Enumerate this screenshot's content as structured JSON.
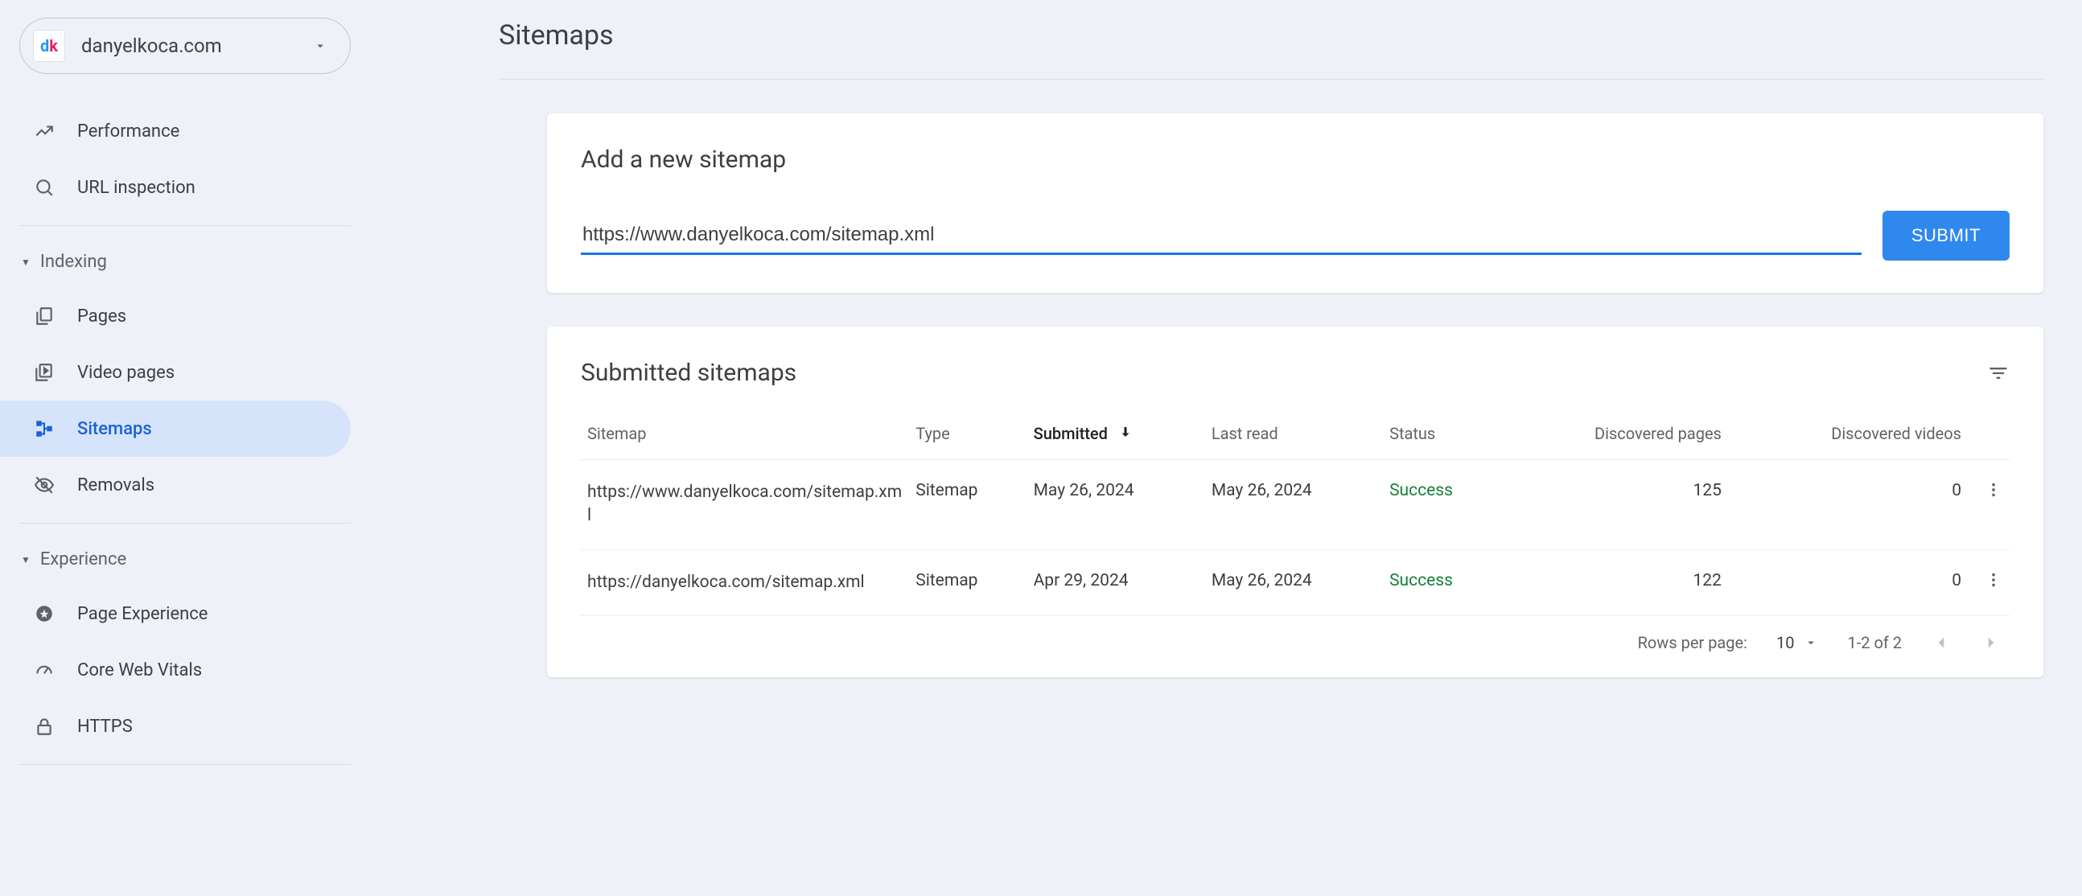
{
  "property": {
    "name": "danyelkoca.com"
  },
  "nav": {
    "performance": "Performance",
    "url_inspection": "URL inspection",
    "indexing_section": "Indexing",
    "pages": "Pages",
    "video_pages": "Video pages",
    "sitemaps": "Sitemaps",
    "removals": "Removals",
    "experience_section": "Experience",
    "page_experience": "Page Experience",
    "core_web_vitals": "Core Web Vitals",
    "https": "HTTPS"
  },
  "page": {
    "title": "Sitemaps",
    "add_card_title": "Add a new sitemap",
    "input_value": "https://www.danyelkoca.com/sitemap.xml",
    "submit_label": "SUBMIT",
    "submitted_card_title": "Submitted sitemaps"
  },
  "table": {
    "headers": {
      "sitemap": "Sitemap",
      "type": "Type",
      "submitted": "Submitted",
      "last_read": "Last read",
      "status": "Status",
      "discovered_pages": "Discovered pages",
      "discovered_videos": "Discovered videos"
    },
    "rows": [
      {
        "sitemap": "https://www.danyelkoca.com/sitemap.xml",
        "type": "Sitemap",
        "submitted": "May 26, 2024",
        "last_read": "May 26, 2024",
        "status": "Success",
        "discovered_pages": "125",
        "discovered_videos": "0"
      },
      {
        "sitemap": "https://danyelkoca.com/sitemap.xml",
        "type": "Sitemap",
        "submitted": "Apr 29, 2024",
        "last_read": "May 26, 2024",
        "status": "Success",
        "discovered_pages": "122",
        "discovered_videos": "0"
      }
    ]
  },
  "footer": {
    "rows_per_page_label": "Rows per page:",
    "rows_per_page_value": "10",
    "range_text": "1-2 of 2"
  }
}
